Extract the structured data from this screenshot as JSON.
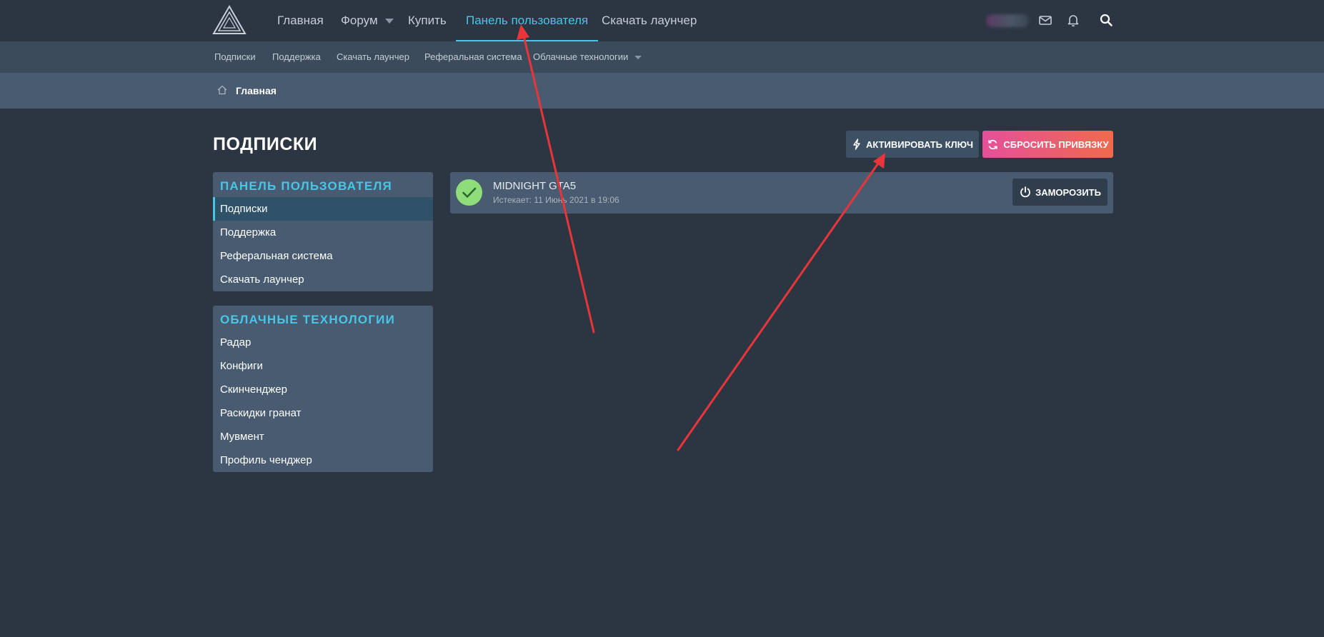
{
  "header": {
    "nav": [
      {
        "label": "Главная"
      },
      {
        "label": "Форум"
      },
      {
        "label": "Купить"
      },
      {
        "label": "Панель пользователя"
      },
      {
        "label": "Скачать лаунчер"
      }
    ],
    "icons": [
      "logo-icon",
      "envelope-icon",
      "bell-icon",
      "search-icon"
    ]
  },
  "subnav": {
    "items": [
      {
        "label": "Подписки"
      },
      {
        "label": "Поддержка"
      },
      {
        "label": "Скачать лаунчер"
      },
      {
        "label": "Реферальная система"
      },
      {
        "label": "Облачные технологии"
      }
    ]
  },
  "breadcrumb": {
    "label": "Главная"
  },
  "page": {
    "title": "ПОДПИСКИ",
    "activate_label": "АКТИВИРОВАТЬ КЛЮЧ",
    "reset_label": "СБРОСИТЬ ПРИВЯЗКУ"
  },
  "sidebar": {
    "panel1": {
      "title": "ПАНЕЛЬ ПОЛЬЗОВАТЕЛЯ",
      "items": [
        {
          "label": "Подписки"
        },
        {
          "label": "Поддержка"
        },
        {
          "label": "Реферальная система"
        },
        {
          "label": "Скачать лаунчер"
        }
      ]
    },
    "panel2": {
      "title": "ОБЛАЧНЫЕ ТЕХНОЛОГИИ",
      "items": [
        {
          "label": "Радар"
        },
        {
          "label": "Конфиги"
        },
        {
          "label": "Скинченджер"
        },
        {
          "label": "Раскидки гранат"
        },
        {
          "label": "Мувмент"
        },
        {
          "label": "Профиль ченджер"
        }
      ]
    }
  },
  "subscription": {
    "name": "MIDNIGHT GTA5",
    "expires": "Истекает: 11 Июнь 2021 в 19:06",
    "freeze_label": "ЗАМОРОЗИТЬ"
  },
  "colors": {
    "background": "#2c3643",
    "accent": "#47c6e8",
    "panel": "#485b70",
    "reset_gradient_start": "#e5509a",
    "reset_gradient_end": "#ef6a4c",
    "annotation_arrow": "#e8353a"
  }
}
